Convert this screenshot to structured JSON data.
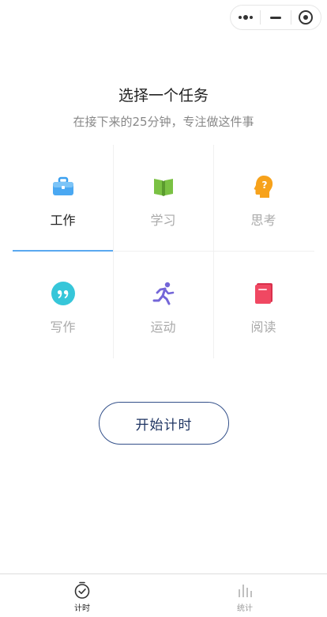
{
  "capsule": {
    "more_icon": "more-dots-icon",
    "minimize_icon": "minimize-icon",
    "close_icon": "target-circle-icon"
  },
  "header": {
    "title": "选择一个任务",
    "subtitle": "在接下来的25分钟，专注做这件事"
  },
  "tasks": [
    {
      "label": "工作",
      "icon": "briefcase-icon",
      "color": "#3aa0f0",
      "selected": true
    },
    {
      "label": "学习",
      "icon": "open-book-icon",
      "color": "#7ac143",
      "selected": false
    },
    {
      "label": "思考",
      "icon": "thinking-head-icon",
      "color": "#f7a21b",
      "selected": false
    },
    {
      "label": "写作",
      "icon": "quote-icon",
      "color": "#36c6d9",
      "selected": false
    },
    {
      "label": "运动",
      "icon": "running-person-icon",
      "color": "#7466d8",
      "selected": false
    },
    {
      "label": "阅读",
      "icon": "book-icon",
      "color": "#f04862",
      "selected": false
    }
  ],
  "start_button": {
    "label": "开始计时"
  },
  "tabbar": {
    "items": [
      {
        "label": "计时",
        "icon": "timer-icon",
        "active": true
      },
      {
        "label": "统计",
        "icon": "bar-chart-icon",
        "active": false
      }
    ]
  },
  "colors": {
    "accent": "#5aa9f0",
    "button_border": "#33508a",
    "button_text": "#1f3563"
  }
}
